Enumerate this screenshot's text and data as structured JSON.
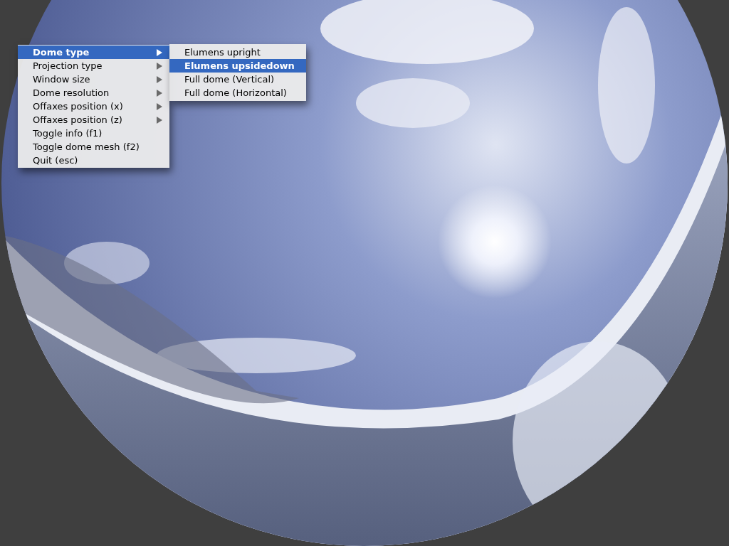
{
  "menu": {
    "items": [
      {
        "label": "Dome type",
        "selected": true,
        "has_submenu": true
      },
      {
        "label": "Projection type",
        "selected": false,
        "has_submenu": true
      },
      {
        "label": "Window size",
        "selected": false,
        "has_submenu": true
      },
      {
        "label": "Dome resolution",
        "selected": false,
        "has_submenu": true
      },
      {
        "label": "Offaxes position (x)",
        "selected": false,
        "has_submenu": true
      },
      {
        "label": "Offaxes position (z)",
        "selected": false,
        "has_submenu": true
      },
      {
        "label": "Toggle info (f1)",
        "selected": false,
        "has_submenu": false
      },
      {
        "label": "Toggle dome mesh (f2)",
        "selected": false,
        "has_submenu": false
      },
      {
        "label": "Quit (esc)",
        "selected": false,
        "has_submenu": false
      }
    ]
  },
  "submenu": {
    "items": [
      {
        "label": "Elumens upright",
        "selected": false
      },
      {
        "label": "Elumens upsidedown",
        "selected": true
      },
      {
        "label": "Full dome (Vertical)",
        "selected": false
      },
      {
        "label": "Full dome (Horizontal)",
        "selected": false
      }
    ]
  }
}
